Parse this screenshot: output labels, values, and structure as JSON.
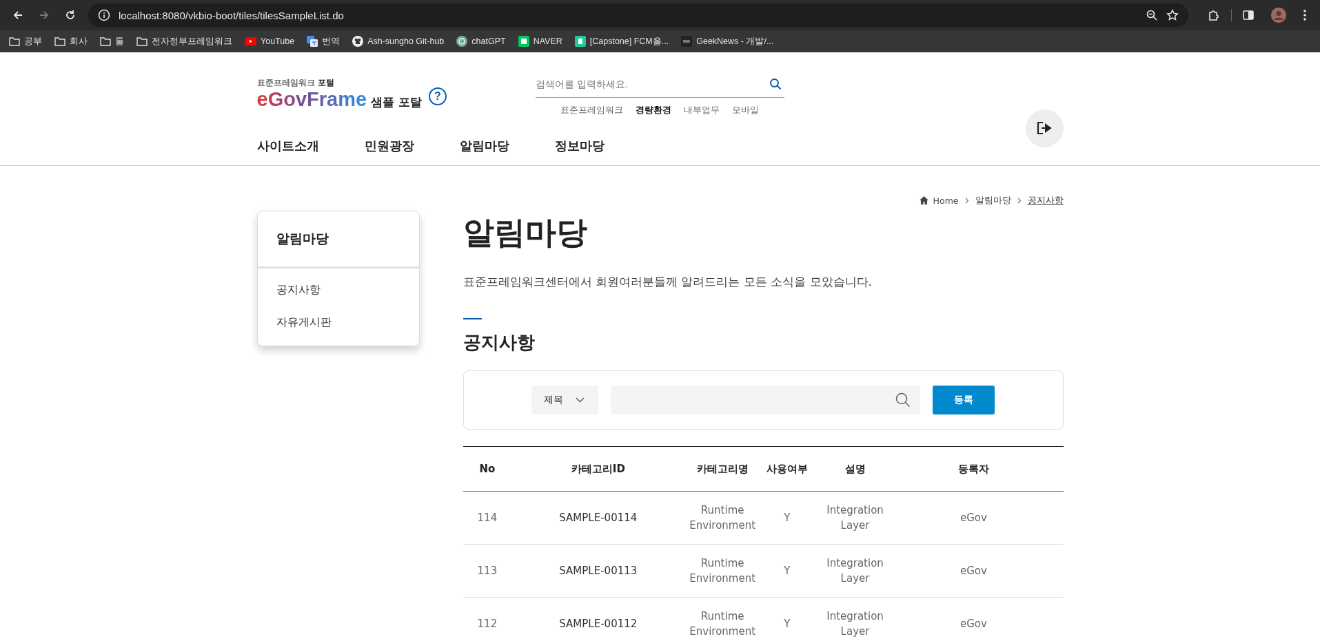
{
  "browser": {
    "nav_buttons": [
      {
        "kind": "back",
        "disabled": false
      },
      {
        "kind": "forward",
        "disabled": true
      },
      {
        "kind": "reload",
        "disabled": false
      }
    ],
    "url": "localhost:8080/vkbio-boot/tiles/tilesSampleList.do",
    "bookmarks": [
      {
        "kind": "folder",
        "label": "공부"
      },
      {
        "kind": "folder",
        "label": "회사"
      },
      {
        "kind": "folder",
        "label": "툴"
      },
      {
        "kind": "folder",
        "label": "전자정부프레임워크"
      },
      {
        "kind": "youtube",
        "label": "YouTube"
      },
      {
        "kind": "translate",
        "label": "번역"
      },
      {
        "kind": "github",
        "label": "Ash-sungho Git-hub"
      },
      {
        "kind": "chatgpt",
        "label": "chatGPT"
      },
      {
        "kind": "naver",
        "label": "NAVER"
      },
      {
        "kind": "vsite",
        "label": "[Capstone] FCM을..."
      },
      {
        "kind": "geeknews",
        "label": "GeekNews - 개발/..."
      }
    ]
  },
  "header": {
    "logo": {
      "subtitle": "표준프레임워크 **포털**",
      "brand": "eGovFrame",
      "suffix": "샘플 포탈",
      "help": "?"
    },
    "search": {
      "placeholder": "검색어를 입력하세요."
    },
    "quick_links": [
      {
        "label": "표준프레임워크",
        "selected": false
      },
      {
        "label": "경량환경",
        "selected": true
      },
      {
        "label": "내부업무",
        "selected": false
      },
      {
        "label": "모바일",
        "selected": false
      }
    ],
    "nav": [
      "사이트소개",
      "민원광장",
      "알림마당",
      "정보마당"
    ]
  },
  "breadcrumb": [
    {
      "label": "Home",
      "selected": false
    },
    {
      "label": "알림마당",
      "selected": false
    },
    {
      "label": "공지사항",
      "selected": true
    }
  ],
  "sidebar": {
    "title": "알림마당",
    "items": [
      "공지사항",
      "자유게시판"
    ]
  },
  "page": {
    "title": "알림마당",
    "description": "표준프레임워크센터에서 회원여러분들께 알려드리는 모든 소식을 모았습니다.",
    "section_title": "공지사항"
  },
  "search_bar": {
    "select": "제목",
    "button": "등록"
  },
  "table": {
    "columns": [
      "No",
      "카테고리ID",
      "카테고리명",
      "사용여부",
      "설명",
      "등록자"
    ],
    "rows": [
      [
        "114",
        "SAMPLE-00114",
        "Runtime Environment",
        "Y",
        "Integration Layer",
        "eGov"
      ],
      [
        "113",
        "SAMPLE-00113",
        "Runtime Environment",
        "Y",
        "Integration Layer",
        "eGov"
      ],
      [
        "112",
        "SAMPLE-00112",
        "Runtime Environment",
        "Y",
        "Integration Layer",
        "eGov"
      ]
    ]
  }
}
